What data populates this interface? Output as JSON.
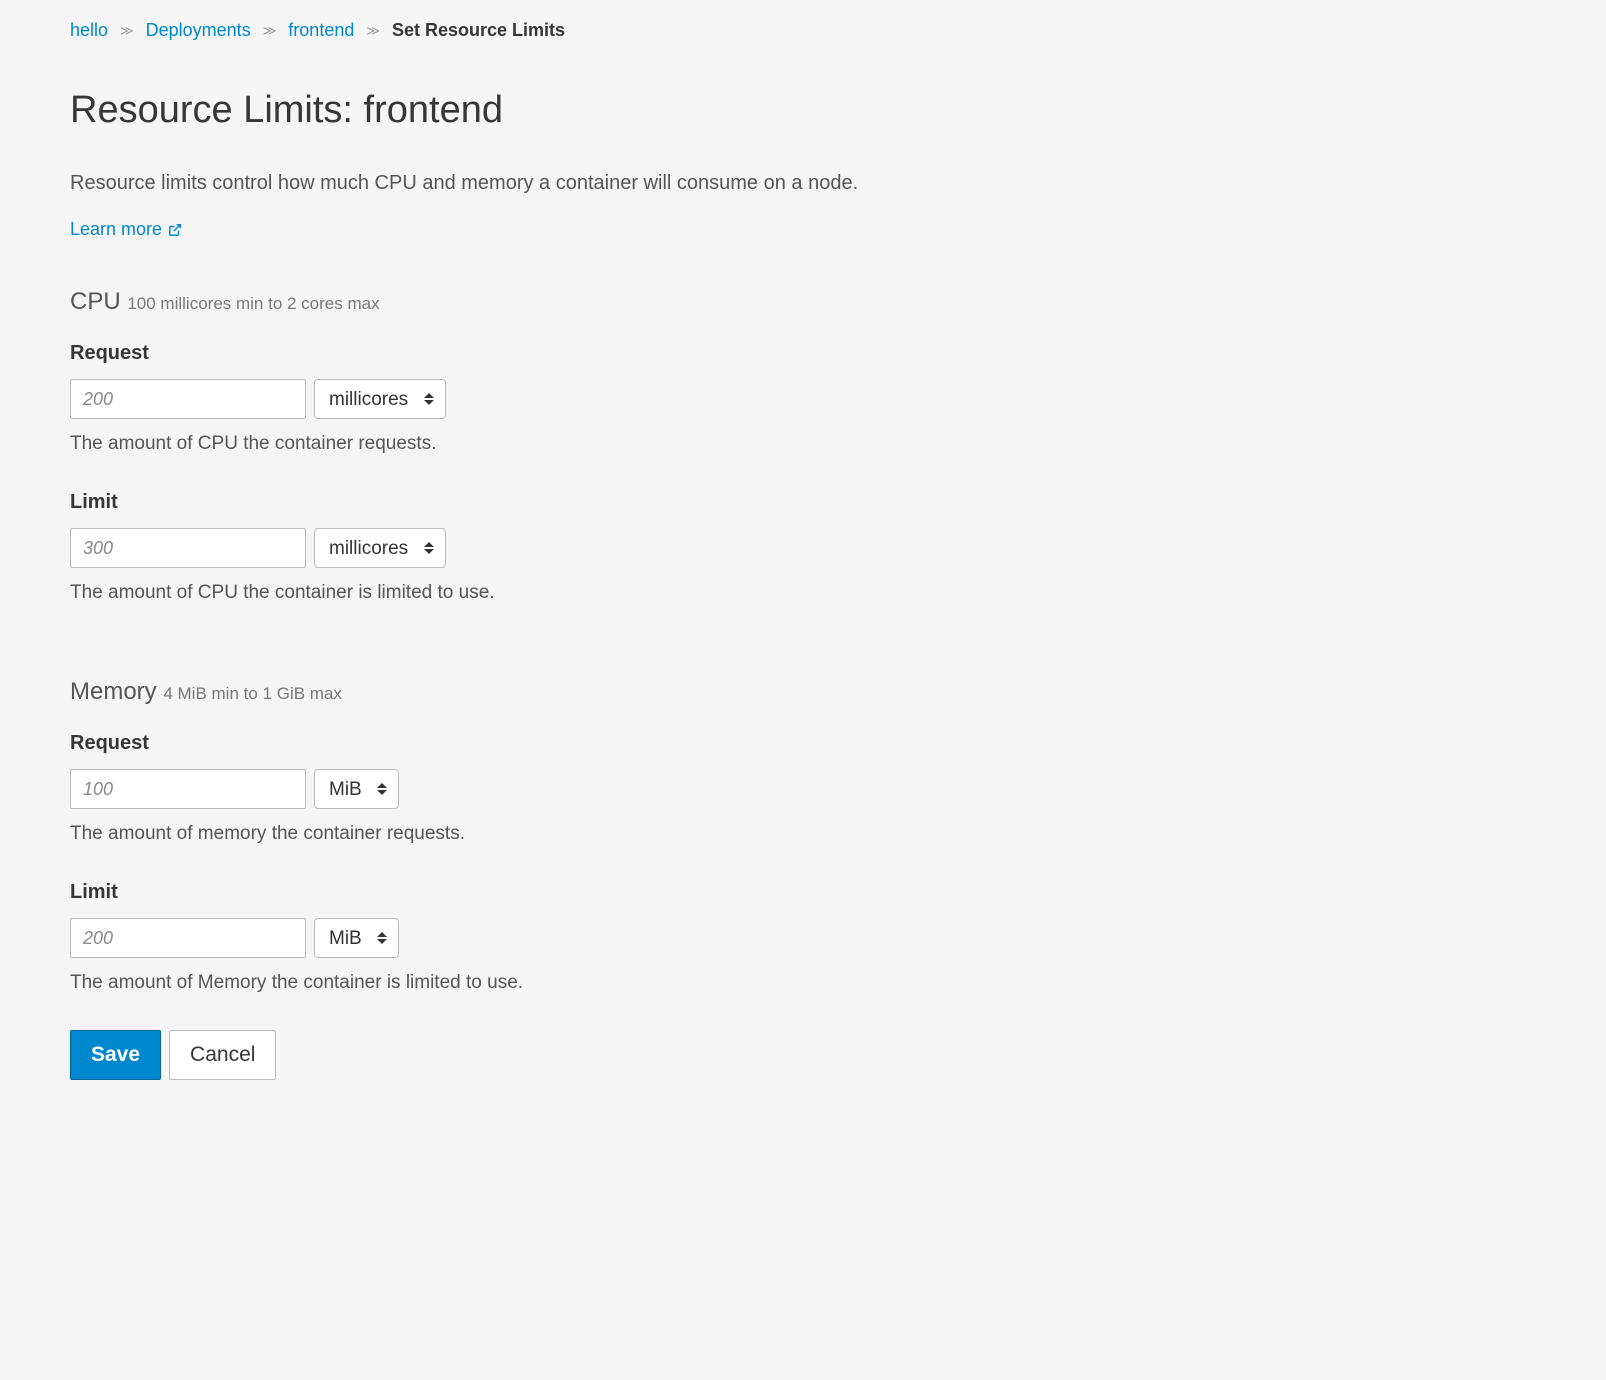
{
  "breadcrumb": {
    "items": [
      {
        "label": "hello"
      },
      {
        "label": "Deployments"
      },
      {
        "label": "frontend"
      }
    ],
    "current": "Set Resource Limits"
  },
  "page": {
    "title": "Resource Limits: frontend",
    "description": "Resource limits control how much CPU and memory a container will consume on a node.",
    "learn_more": "Learn more"
  },
  "cpu": {
    "heading": "CPU",
    "range": "100 millicores min to 2 cores max",
    "request": {
      "label": "Request",
      "placeholder": "200",
      "unit": "millicores",
      "help": "The amount of CPU the container requests."
    },
    "limit": {
      "label": "Limit",
      "placeholder": "300",
      "unit": "millicores",
      "help": "The amount of CPU the container is limited to use."
    }
  },
  "memory": {
    "heading": "Memory",
    "range": "4 MiB min to 1 GiB max",
    "request": {
      "label": "Request",
      "placeholder": "100",
      "unit": "MiB",
      "help": "The amount of memory the container requests."
    },
    "limit": {
      "label": "Limit",
      "placeholder": "200",
      "unit": "MiB",
      "help": "The amount of Memory the container is limited to use."
    }
  },
  "actions": {
    "save": "Save",
    "cancel": "Cancel"
  }
}
